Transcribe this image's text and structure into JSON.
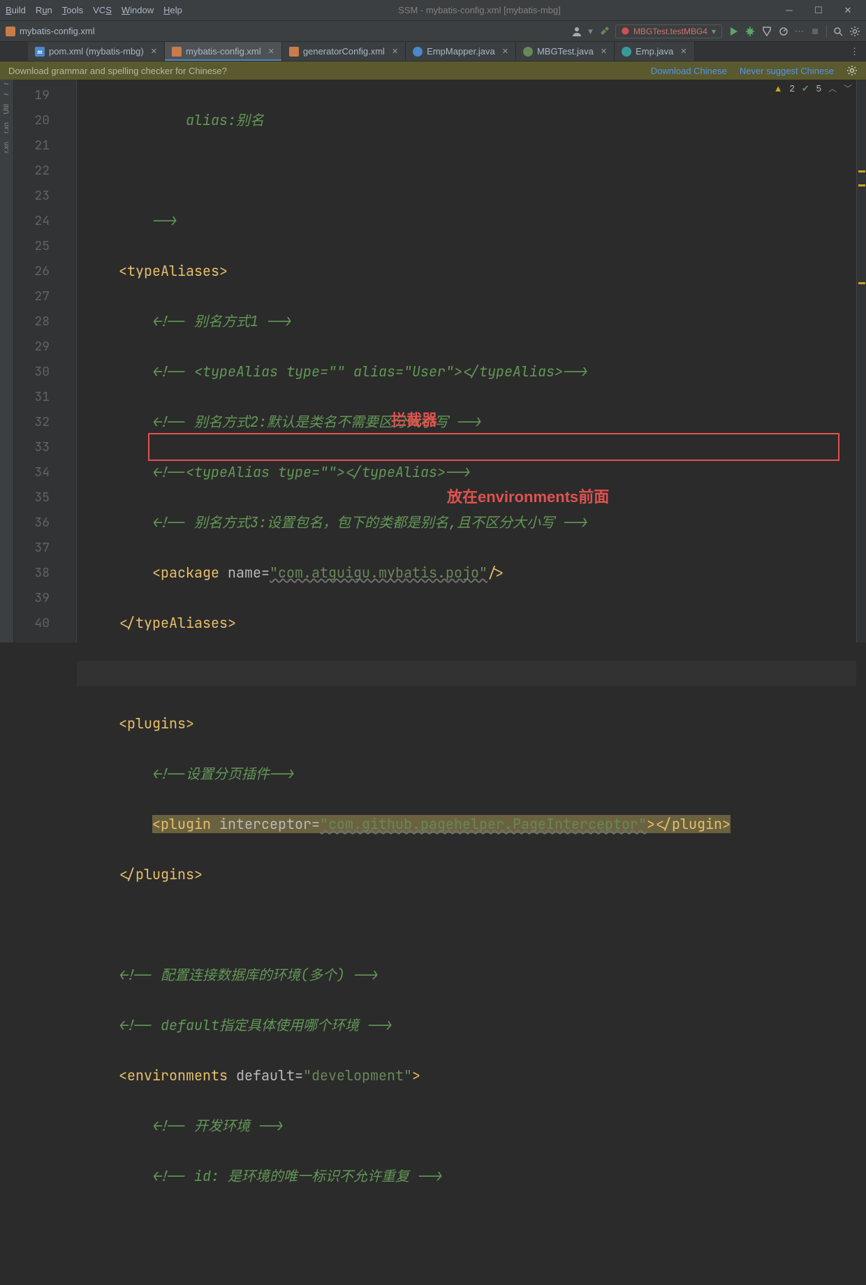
{
  "menus": [
    "Build",
    "Run",
    "Tools",
    "VCS",
    "Window",
    "Help"
  ],
  "menu_mnemonics": [
    0,
    0,
    0,
    0,
    0,
    0
  ],
  "window_title": "SSM - mybatis-config.xml [mybatis-mbg]",
  "nav_file": "mybatis-config.xml",
  "run_config_label": "MBGTest.testMBG4",
  "tabs": [
    {
      "label": "pom.xml (mybatis-mbg)",
      "active": false,
      "icon": "m"
    },
    {
      "label": "mybatis-config.xml",
      "active": true,
      "icon": "xml"
    },
    {
      "label": "generatorConfig.xml",
      "active": false,
      "icon": "xml"
    },
    {
      "label": "EmpMapper.java",
      "active": false,
      "icon": "java-blue"
    },
    {
      "label": "MBGTest.java",
      "active": false,
      "icon": "java-green"
    },
    {
      "label": "Emp.java",
      "active": false,
      "icon": "java-teal"
    }
  ],
  "banner": {
    "text": "Download grammar and spelling checker for Chinese?",
    "link1": "Download Chinese",
    "link2": "Never suggest Chinese"
  },
  "inspection": {
    "warn_count": "2",
    "ok_count": "5"
  },
  "lines": [
    19,
    20,
    21,
    22,
    23,
    24,
    25,
    26,
    27,
    28,
    29,
    30,
    31,
    32,
    33,
    34,
    35,
    36,
    37,
    38,
    39,
    40
  ],
  "code": {
    "l19": "alias:别名",
    "l21": "-->",
    "l23": "<!-- 别名方式1 -->",
    "l24": "<!-- <typeAlias type=\"\" alias=\"User\"></typeAlias>-->",
    "l25": "<!-- 别名方式2:默认是类名不需要区分大小写 -->",
    "l26": "<!--<typeAlias type=\"\"></typeAlias>-->",
    "l27": "<!-- 别名方式3:设置包名，包下的类都是别名,且不区分大小写 -->",
    "l28_name": "name=",
    "l28_val": "\"com.atguigu.mybatis.pojo\"",
    "l32": "<!--设置分页插件-->",
    "l33_attr": "interceptor=",
    "l33_val": "\"com.github.pagehelper.PageInterceptor\"",
    "l36": "<!-- 配置连接数据库的环境(多个) -->",
    "l37": "<!-- default指定具体使用哪个环境 -->",
    "l38_attr": "default=",
    "l38_val": "\"development\"",
    "l39": "<!-- 开发环境 -->",
    "l40": "<!-- id: 是环境的唯一标识不允许重复 -->",
    "tag_typeAliases_open": "typeAliases",
    "tag_typeAliases_close": "typeAliases",
    "tag_package": "package",
    "tag_plugins": "plugins",
    "tag_plugin": "plugin",
    "tag_environments": "environments"
  },
  "annotations": {
    "label1": "拦截器",
    "label2": "放在environments前面"
  },
  "rail_items": [
    "r",
    "r",
    "Util",
    "r.xn",
    "r.xn"
  ]
}
